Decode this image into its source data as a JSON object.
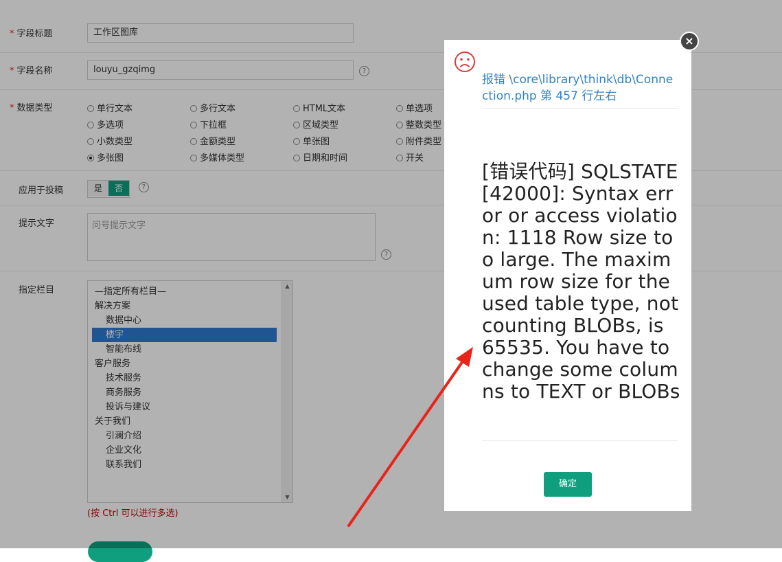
{
  "form": {
    "field_title": {
      "label": "字段标题",
      "value": "工作区图库"
    },
    "field_name": {
      "label": "字段名称",
      "value": "louyu_gzqimg",
      "help": "?"
    },
    "data_type": {
      "label": "数据类型",
      "options": [
        [
          "单行文本",
          "多行文本",
          "HTML文本",
          "单选项"
        ],
        [
          "多选项",
          "下拉框",
          "区域类型",
          "整数类型"
        ],
        [
          "小数类型",
          "金额类型",
          "单张图",
          "附件类型"
        ],
        [
          "多张图",
          "多媒体类型",
          "日期和时间",
          "开关"
        ]
      ],
      "selected": "多张图"
    },
    "apply_to_submission": {
      "label": "应用于投稿",
      "yes": "是",
      "no": "否",
      "selected": "否",
      "help": "?"
    },
    "hint_text": {
      "label": "提示文字",
      "placeholder": "问号提示文字",
      "help": "?"
    },
    "columns": {
      "label": "指定栏目",
      "options": [
        {
          "text": "—指定所有栏目—",
          "level": 0
        },
        {
          "text": "解决方案",
          "level": 0
        },
        {
          "text": "数据中心",
          "level": 1
        },
        {
          "text": "楼宇",
          "level": 1,
          "selected": true
        },
        {
          "text": "智能布线",
          "level": 1
        },
        {
          "text": "客户服务",
          "level": 0
        },
        {
          "text": "技术服务",
          "level": 1
        },
        {
          "text": "商务服务",
          "level": 1
        },
        {
          "text": "投诉与建议",
          "level": 1
        },
        {
          "text": "关于我们",
          "level": 0
        },
        {
          "text": "引澜介绍",
          "level": 1
        },
        {
          "text": "企业文化",
          "level": 1
        },
        {
          "text": "联系我们",
          "level": 1
        }
      ],
      "multi_hint": "(按 Ctrl 可以进行多选)"
    }
  },
  "dialog": {
    "icon": "sad-face-icon",
    "title": "报错 \\core\\library\\think\\db\\Connection.php 第 457 行左右",
    "message": "[错误代码] SQLSTATE[42000]: Syntax error or access violation: 1118 Row size too large. The maximum row size for the used table type, not counting BLOBs, is 65535. You have to change some columns to TEXT or BLOBs",
    "ok_label": "确定",
    "close_label": "×"
  },
  "colors": {
    "accent": "#0f9f7f",
    "error_icon": "#e03a3a",
    "title_link": "#2f82c8",
    "arrow": "#e8231a"
  }
}
